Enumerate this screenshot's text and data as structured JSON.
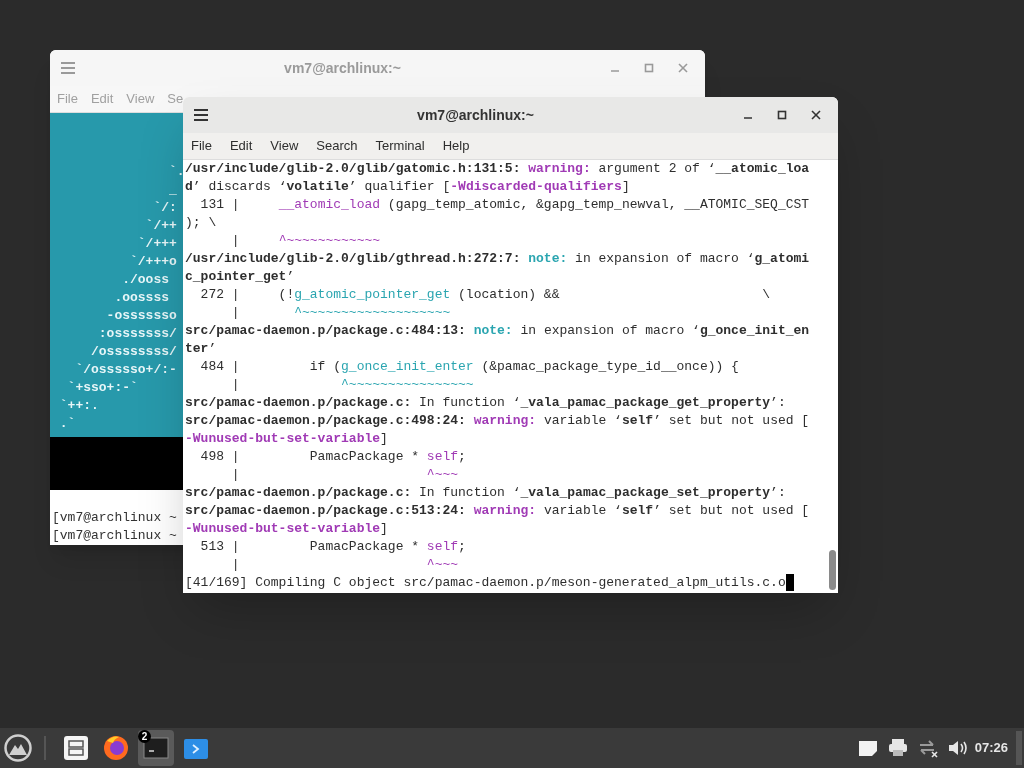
{
  "windows": [
    {
      "title": "vm7@archlinux:~",
      "active": false,
      "menu": [
        "File",
        "Edit",
        "View",
        "Se"
      ],
      "ascii_art": [
        "               `.",
        "               _",
        "             `/:",
        "            `/++",
        "           `/+++",
        "          `/+++o",
        "         ./ooss",
        "        .oossss",
        "       -osssssso",
        "      :osssssss/",
        "     /ossssssss/",
        "   `/ossssso+/:-",
        "  `+sso+:-`",
        " `++:.",
        " .`"
      ],
      "prompts": [
        "[vm7@archlinux ~",
        "[vm7@archlinux ~"
      ]
    },
    {
      "title": "vm7@archlinux:~",
      "active": true,
      "menu": [
        "File",
        "Edit",
        "View",
        "Search",
        "Terminal",
        "Help"
      ],
      "lines": [
        {
          "parts": [
            {
              "kind": "bold",
              "text": "/usr/include/glib-2.0/glib/gatomic.h:131:5:"
            },
            {
              "kind": "warning",
              "text": " warning:"
            },
            {
              "kind": "plain",
              "text": " argument 2 of ‘"
            },
            {
              "kind": "bold",
              "text": "__atomic_loa"
            }
          ]
        },
        {
          "parts": [
            {
              "kind": "bold",
              "text": "d"
            },
            {
              "kind": "plain",
              "text": "’ discards ‘"
            },
            {
              "kind": "bold",
              "text": "volatile"
            },
            {
              "kind": "plain",
              "text": "’ qualifier ["
            },
            {
              "kind": "warning",
              "text": "-Wdiscarded-qualifiers"
            },
            {
              "kind": "plain",
              "text": "]"
            }
          ]
        },
        {
          "parts": [
            {
              "kind": "plain",
              "text": "  131 |     "
            },
            {
              "kind": "purple",
              "text": "__atomic_load"
            },
            {
              "kind": "plain",
              "text": " (gapg_temp_atomic, &gapg_temp_newval, __ATOMIC_SEQ_CST"
            }
          ]
        },
        {
          "parts": [
            {
              "kind": "plain",
              "text": "); \\"
            }
          ]
        },
        {
          "parts": [
            {
              "kind": "plain",
              "text": "      |     "
            },
            {
              "kind": "purple",
              "text": "^~~~~~~~~~~~~"
            }
          ]
        },
        {
          "parts": [
            {
              "kind": "bold",
              "text": "/usr/include/glib-2.0/glib/gthread.h:272:7:"
            },
            {
              "kind": "note",
              "text": " note:"
            },
            {
              "kind": "plain",
              "text": " in expansion of macro ‘"
            },
            {
              "kind": "bold",
              "text": "g_atomi"
            }
          ]
        },
        {
          "parts": [
            {
              "kind": "bold",
              "text": "c_pointer_get"
            },
            {
              "kind": "plain",
              "text": "’"
            }
          ]
        },
        {
          "parts": [
            {
              "kind": "plain",
              "text": "  272 |     (!"
            },
            {
              "kind": "teal",
              "text": "g_atomic_pointer_get"
            },
            {
              "kind": "plain",
              "text": " (location) &&                          \\"
            }
          ]
        },
        {
          "parts": [
            {
              "kind": "plain",
              "text": "      |       "
            },
            {
              "kind": "teal",
              "text": "^~~~~~~~~~~~~~~~~~~~"
            }
          ]
        },
        {
          "parts": [
            {
              "kind": "bold",
              "text": "src/pamac-daemon.p/package.c:484:13:"
            },
            {
              "kind": "note",
              "text": " note:"
            },
            {
              "kind": "plain",
              "text": " in expansion of macro ‘"
            },
            {
              "kind": "bold",
              "text": "g_once_init_en"
            }
          ]
        },
        {
          "parts": [
            {
              "kind": "bold",
              "text": "ter"
            },
            {
              "kind": "plain",
              "text": "’"
            }
          ]
        },
        {
          "parts": [
            {
              "kind": "plain",
              "text": "  484 |         if ("
            },
            {
              "kind": "teal",
              "text": "g_once_init_enter"
            },
            {
              "kind": "plain",
              "text": " (&pamac_package_type_id__once)) {"
            }
          ]
        },
        {
          "parts": [
            {
              "kind": "plain",
              "text": "      |             "
            },
            {
              "kind": "teal",
              "text": "^~~~~~~~~~~~~~~~~"
            }
          ]
        },
        {
          "parts": [
            {
              "kind": "bold",
              "text": "src/pamac-daemon.p/package.c:"
            },
            {
              "kind": "plain",
              "text": " In function ‘"
            },
            {
              "kind": "bold",
              "text": "_vala_pamac_package_get_property"
            },
            {
              "kind": "plain",
              "text": "’:"
            }
          ]
        },
        {
          "parts": [
            {
              "kind": "bold",
              "text": "src/pamac-daemon.p/package.c:498:24:"
            },
            {
              "kind": "warning",
              "text": " warning:"
            },
            {
              "kind": "plain",
              "text": " variable ‘"
            },
            {
              "kind": "bold",
              "text": "self"
            },
            {
              "kind": "plain",
              "text": "’ set but not used ["
            }
          ]
        },
        {
          "parts": [
            {
              "kind": "warning",
              "text": "-Wunused-but-set-variable"
            },
            {
              "kind": "plain",
              "text": "]"
            }
          ]
        },
        {
          "parts": [
            {
              "kind": "plain",
              "text": "  498 |         PamacPackage * "
            },
            {
              "kind": "purple",
              "text": "self"
            },
            {
              "kind": "plain",
              "text": ";"
            }
          ]
        },
        {
          "parts": [
            {
              "kind": "plain",
              "text": "      |                        "
            },
            {
              "kind": "purple",
              "text": "^~~~"
            }
          ]
        },
        {
          "parts": [
            {
              "kind": "bold",
              "text": "src/pamac-daemon.p/package.c:"
            },
            {
              "kind": "plain",
              "text": " In function ‘"
            },
            {
              "kind": "bold",
              "text": "_vala_pamac_package_set_property"
            },
            {
              "kind": "plain",
              "text": "’:"
            }
          ]
        },
        {
          "parts": [
            {
              "kind": "bold",
              "text": "src/pamac-daemon.p/package.c:513:24:"
            },
            {
              "kind": "warning",
              "text": " warning:"
            },
            {
              "kind": "plain",
              "text": " variable ‘"
            },
            {
              "kind": "bold",
              "text": "self"
            },
            {
              "kind": "plain",
              "text": "’ set but not used ["
            }
          ]
        },
        {
          "parts": [
            {
              "kind": "warning",
              "text": "-Wunused-but-set-variable"
            },
            {
              "kind": "plain",
              "text": "]"
            }
          ]
        },
        {
          "parts": [
            {
              "kind": "plain",
              "text": "  513 |         PamacPackage * "
            },
            {
              "kind": "purple",
              "text": "self"
            },
            {
              "kind": "plain",
              "text": ";"
            }
          ]
        },
        {
          "parts": [
            {
              "kind": "plain",
              "text": "      |                        "
            },
            {
              "kind": "purple",
              "text": "^~~~"
            }
          ]
        },
        {
          "parts": [
            {
              "kind": "plain",
              "text": "[41/169] Compiling C object src/pamac-daemon.p/meson-generated_alpm_utils.c.o"
            }
          ],
          "cursor": true
        }
      ]
    }
  ],
  "taskbar": {
    "apps": [
      {
        "kind": "files",
        "selected": false
      },
      {
        "kind": "browser",
        "selected": false
      },
      {
        "kind": "terminal",
        "selected": true,
        "badge": "2"
      },
      {
        "kind": "store",
        "selected": false
      }
    ],
    "tray": [
      {
        "kind": "notes"
      },
      {
        "kind": "printer"
      },
      {
        "kind": "network"
      },
      {
        "kind": "volume"
      }
    ],
    "clock": "07:26"
  }
}
